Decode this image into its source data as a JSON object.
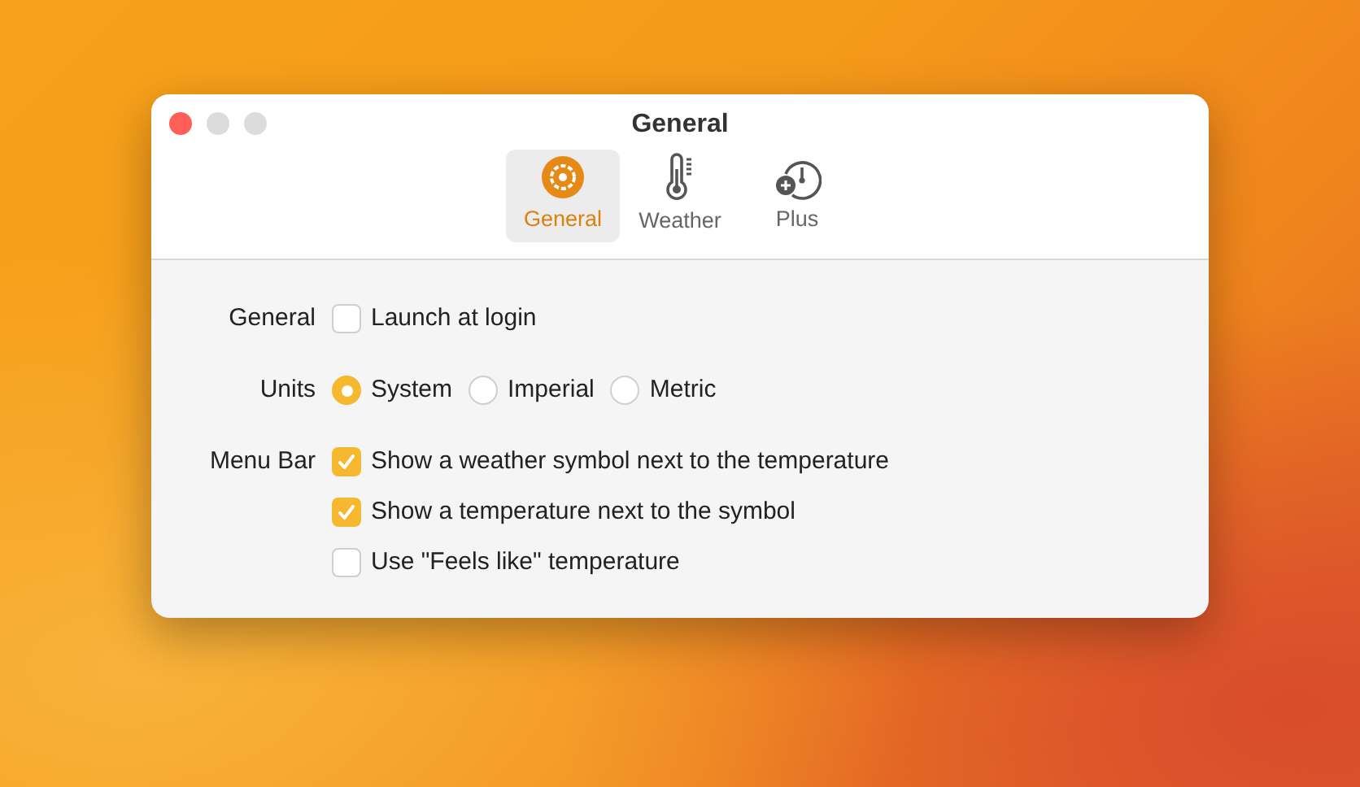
{
  "window": {
    "title": "General"
  },
  "tabs": [
    {
      "label": "General",
      "selected": true,
      "kind": "gear"
    },
    {
      "label": "Weather",
      "selected": false,
      "kind": "thermometer"
    },
    {
      "label": "Plus",
      "selected": false,
      "kind": "gauge"
    }
  ],
  "rows": [
    {
      "label": "General",
      "kind": "checks",
      "options": [
        {
          "label": "Launch at login",
          "checked": false
        }
      ]
    },
    {
      "label": "Units",
      "kind": "radios",
      "options": [
        {
          "label": "System",
          "selected": true
        },
        {
          "label": "Imperial",
          "selected": false
        },
        {
          "label": "Metric",
          "selected": false
        }
      ]
    },
    {
      "label": "Menu Bar",
      "kind": "checks",
      "options": [
        {
          "label": "Show a weather symbol next to the temperature",
          "checked": true
        },
        {
          "label": "Show a temperature next to the symbol",
          "checked": true
        },
        {
          "label": "Use \"Feels like\" temperature",
          "checked": false
        }
      ]
    }
  ]
}
